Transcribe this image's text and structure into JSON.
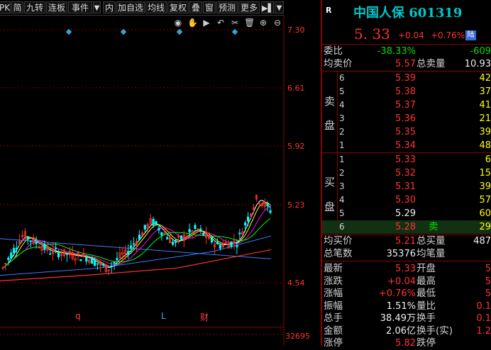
{
  "toolbar": {
    "items": [
      "PK",
      "简",
      "九转",
      "连板",
      "事件",
      "内",
      "加自选",
      "均线",
      "复权",
      "叠",
      "窗",
      "预测",
      "更多"
    ],
    "more_arrow": "▼"
  },
  "chart": {
    "price_ticks": [
      "7.30",
      "6.61",
      "5.92",
      "5.23",
      "4.54"
    ],
    "volume_tick": "32695",
    "event_markers": [
      "q",
      "L",
      "财"
    ],
    "icons": [
      "eye-icon",
      "hand-icon",
      "play-icon",
      "undo-icon",
      "scissors-icon",
      "trash-icon",
      "zoom-in-icon",
      "zoom-out-icon"
    ],
    "colors": {
      "up": "#ff3232",
      "down": "#00ffff",
      "ma5": "#ffffff",
      "ma10": "#ffff00",
      "ma20": "#ff00ff",
      "ma30": "#00ff00",
      "ma60": "#3a7dff",
      "ma120": "#ff3030",
      "grid": "#8b0000"
    }
  },
  "quote": {
    "tag": "R",
    "title": "中国人保 601319",
    "price": "5. 33",
    "change": "+0.04",
    "change_pct": "+0.76%",
    "market_badge": "陆"
  },
  "book": {
    "weibi_label": "委比",
    "weibi_value": "-38.33%",
    "weicha_value": "-609",
    "jmj_label": "均卖价",
    "jmj_value": "5.57",
    "zml_label": "总卖量",
    "zml_value": "10.93",
    "sell_label_1": "卖",
    "sell_label_2": "盘",
    "sells": [
      {
        "n": "6",
        "p": "5.39",
        "v": "42"
      },
      {
        "n": "5",
        "p": "5.38",
        "v": "37"
      },
      {
        "n": "4",
        "p": "5.37",
        "v": "41"
      },
      {
        "n": "3",
        "p": "5.36",
        "v": "21"
      },
      {
        "n": "2",
        "p": "5.35",
        "v": "39"
      },
      {
        "n": "1",
        "p": "5.34",
        "v": "48"
      }
    ],
    "buy_label_1": "买",
    "buy_label_2": "盘",
    "buys": [
      {
        "n": "1",
        "p": "5.33",
        "v": "6"
      },
      {
        "n": "2",
        "p": "5.32",
        "v": "15"
      },
      {
        "n": "3",
        "p": "5.31",
        "v": "39"
      },
      {
        "n": "4",
        "p": "5.30",
        "v": "57"
      },
      {
        "n": "5",
        "p": "5.29",
        "v": "60"
      },
      {
        "n": "6",
        "p": "5.28",
        "v": "29",
        "tag": "卖"
      }
    ],
    "jmrj_label": "均买价",
    "jmrj_value": "5.21",
    "zmrl_label": "总买量",
    "zmrl_value": "487",
    "zbs_label": "总笔数",
    "zbs_value": "35376",
    "jbl_label": "均笔量"
  },
  "stats": [
    {
      "l1": "最新",
      "v1": "5.33",
      "c1": "red",
      "l2": "开盘",
      "v2": "5"
    },
    {
      "l1": "涨跌",
      "v1": "+0.04",
      "c1": "red",
      "l2": "最高",
      "v2": "5"
    },
    {
      "l1": "涨幅",
      "v1": "+0.76%",
      "c1": "red",
      "l2": "最低",
      "v2": "5"
    },
    {
      "l1": "振幅",
      "v1": "1.51%",
      "c1": "wht",
      "l2": "量比",
      "v2": "0.1"
    },
    {
      "l1": "总手",
      "v1": "38.49万",
      "c1": "wht",
      "l2": "换手",
      "v2": "0.1"
    },
    {
      "l1": "金额",
      "v1": "2.06亿",
      "c1": "wht",
      "l2": "换手(实)",
      "v2": "1.2"
    },
    {
      "l1": "涨停",
      "v1": "5.82",
      "c1": "red",
      "l2": "跌停",
      "v2": ""
    }
  ]
}
